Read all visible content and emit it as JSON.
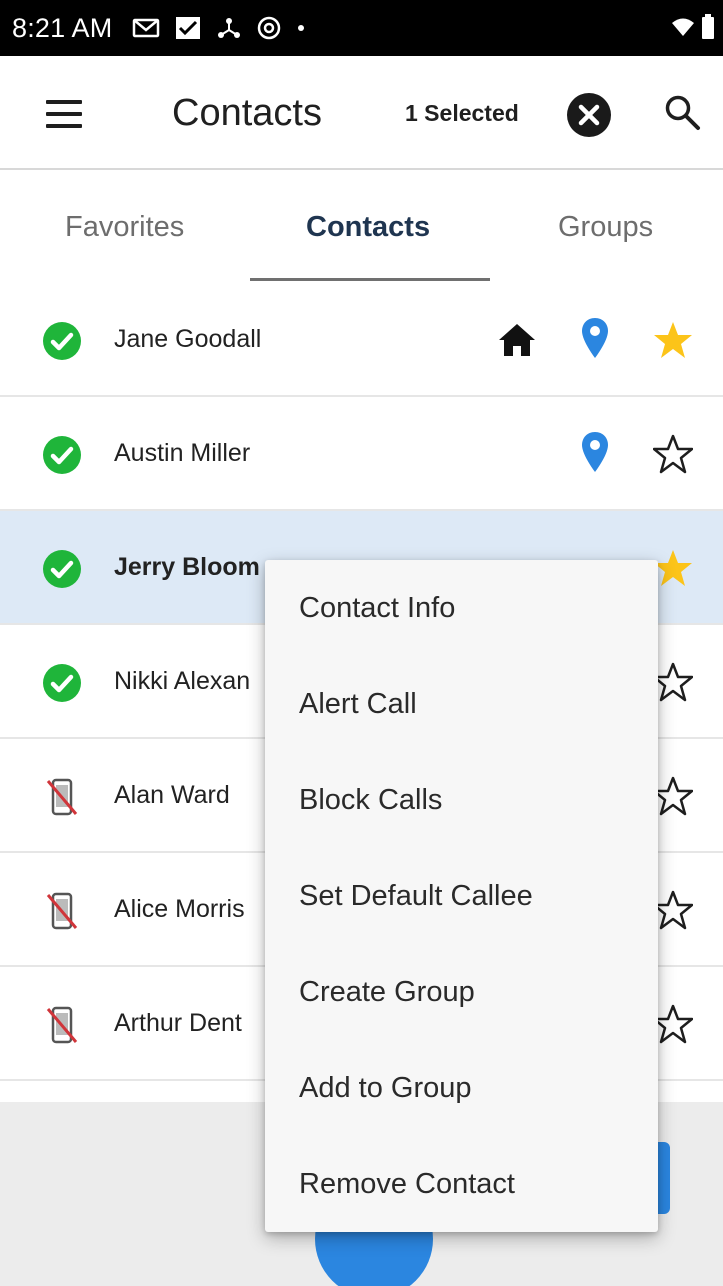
{
  "status_bar": {
    "time": "8:21 AM",
    "icons": [
      "gmail-icon",
      "message-check-icon",
      "network-icon",
      "sync-icon",
      "dot-icon"
    ],
    "right_icons": [
      "wifi-icon",
      "battery-icon"
    ]
  },
  "app_bar": {
    "title": "Contacts",
    "selected_count": "1 Selected",
    "icons": [
      "menu-icon",
      "clear-selection-icon",
      "search-icon"
    ]
  },
  "tabs": [
    {
      "label": "Favorites",
      "active": false
    },
    {
      "label": "Contacts",
      "active": true
    },
    {
      "label": "Groups",
      "active": false
    }
  ],
  "contacts": [
    {
      "name": "Jane Goodall",
      "status": "online",
      "home": true,
      "location": true,
      "favorite": true,
      "selected": false
    },
    {
      "name": "Austin Miller",
      "status": "online",
      "home": false,
      "location": true,
      "favorite": false,
      "selected": false
    },
    {
      "name": "Jerry Bloom",
      "status": "online",
      "home": false,
      "location": false,
      "favorite": true,
      "selected": true
    },
    {
      "name": "Nikki Alexan",
      "status": "online",
      "home": false,
      "location": false,
      "favorite": false,
      "selected": false
    },
    {
      "name": "Alan Ward",
      "status": "no-device",
      "home": false,
      "location": false,
      "favorite": false,
      "selected": false
    },
    {
      "name": "Alice Morris",
      "status": "no-device",
      "home": false,
      "location": false,
      "favorite": false,
      "selected": false
    },
    {
      "name": "Arthur Dent",
      "status": "no-device",
      "home": false,
      "location": false,
      "favorite": false,
      "selected": false
    }
  ],
  "context_menu": {
    "items": [
      "Contact Info",
      "Alert Call",
      "Block Calls",
      "Set Default Callee",
      "Create Group",
      "Add to Group",
      "Remove Contact"
    ]
  },
  "colors": {
    "online_green": "#1fb53a",
    "favorite_yellow": "#fcc419",
    "location_blue": "#2b86e0",
    "selected_row": "#dde9f6",
    "no_device_red": "#d0353a"
  }
}
